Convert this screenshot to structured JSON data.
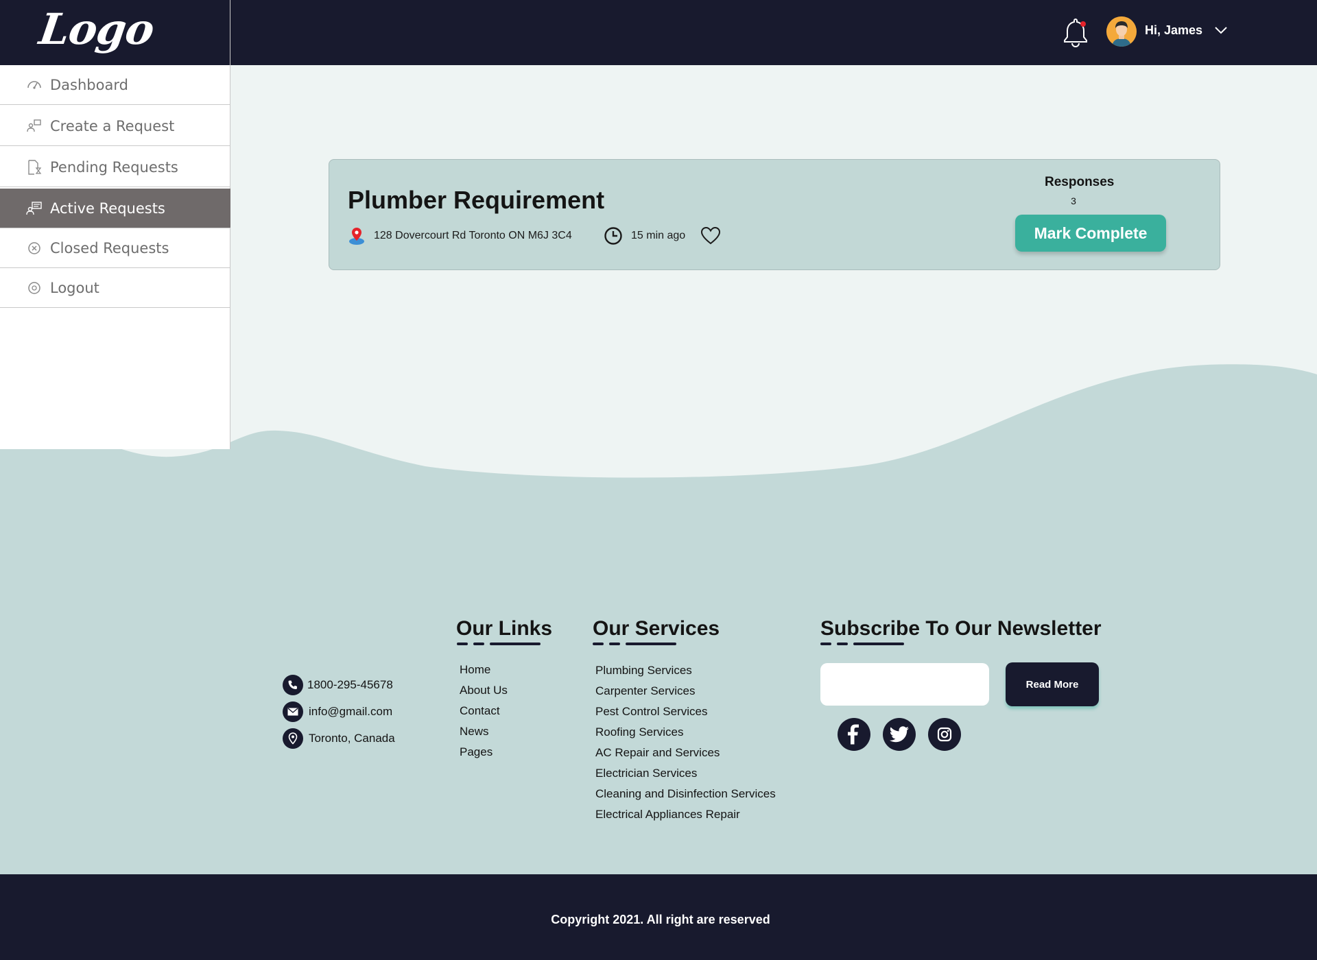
{
  "header": {
    "logo": "Logo",
    "greeting": "Hi, James"
  },
  "sidebar": {
    "items": [
      {
        "label": "Dashboard",
        "icon": "dashboard-icon"
      },
      {
        "label": "Create a Request",
        "icon": "create-request-icon"
      },
      {
        "label": "Pending Requests",
        "icon": "pending-icon"
      },
      {
        "label": "Active Requests",
        "icon": "active-requests-icon",
        "active": true
      },
      {
        "label": "Closed Requests",
        "icon": "closed-icon"
      },
      {
        "label": "Logout",
        "icon": "logout-icon"
      }
    ]
  },
  "request": {
    "title": "Plumber Requirement",
    "address": "128 Dovercourt Rd Toronto ON M6J 3C4",
    "time": "15 min ago",
    "responses_label": "Responses",
    "responses_count": "3",
    "mark_complete_label": "Mark Complete"
  },
  "footer": {
    "contact": {
      "phone": "1800-295-45678",
      "email": "info@gmail.com",
      "location": "Toronto, Canada"
    },
    "links_heading": "Our Links",
    "links": [
      "Home",
      "About Us",
      "Contact",
      "News",
      "Pages"
    ],
    "services_heading": "Our Services",
    "services": [
      "Plumbing Services",
      "Carpenter Services",
      "Pest Control Services",
      "Roofing Services",
      "AC Repair and Services",
      "Electrician Services",
      "Cleaning and Disinfection Services",
      "Electrical Appliances Repair"
    ],
    "newsletter_heading": "Subscribe To Our Newsletter",
    "newsletter_placeholder": "",
    "read_more_label": "Read More",
    "copyright": "Copyright 2021. All right are reserved"
  },
  "colors": {
    "dark_navy": "#181a2e",
    "accent_teal": "#3ab09d",
    "card_bg": "#c2d8d6",
    "page_bg": "#eef4f3",
    "active_nav_bg": "#6f6a6a"
  }
}
